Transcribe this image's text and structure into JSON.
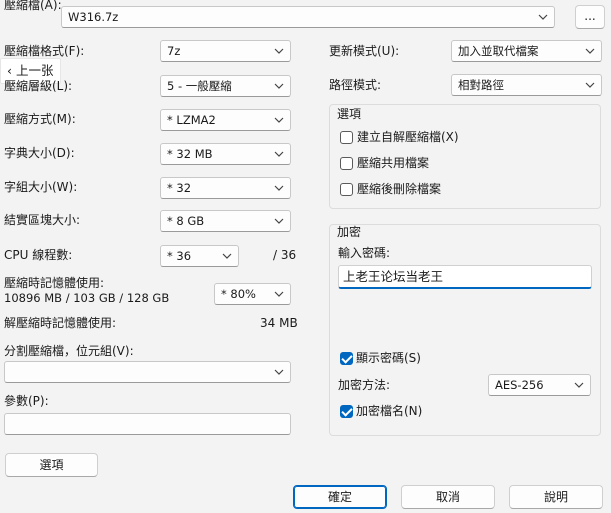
{
  "archive": {
    "label": "壓縮檔(A):",
    "value": "W316.7z",
    "browse_label": "..."
  },
  "back_tip": {
    "label": "上一张"
  },
  "left": {
    "format": {
      "label": "壓縮檔格式(F):",
      "value": "7z"
    },
    "level": {
      "label": "壓縮層級(L):",
      "value": "5 - 一般壓縮"
    },
    "method": {
      "label": "壓縮方式(M):",
      "value": "* LZMA2"
    },
    "dict": {
      "label": "字典大小(D):",
      "value": "* 32 MB"
    },
    "word": {
      "label": "字組大小(W):",
      "value": "* 32"
    },
    "solid": {
      "label": "結實區塊大小:",
      "value": "* 8 GB"
    },
    "cpu": {
      "label": "CPU 線程數:",
      "value": "* 36",
      "max": "/ 36"
    },
    "mem": {
      "label": "壓縮時記憶體使用:",
      "detail": "10896 MB / 103 GB / 128 GB",
      "value": "* 80%"
    },
    "decomp": {
      "label": "解壓縮時記憶體使用:",
      "value": "34 MB"
    },
    "split": {
      "label": "分割壓縮檔，位元組(V):",
      "value": ""
    },
    "params": {
      "label": "參數(P):",
      "value": ""
    },
    "options_button": "選項"
  },
  "right": {
    "update": {
      "label": "更新模式(U):",
      "value": "加入並取代檔案"
    },
    "path": {
      "label": "路徑模式:",
      "value": "相對路徑"
    },
    "options_group": {
      "title": "選項",
      "sfx": "建立自解壓縮檔(X)",
      "shared": "壓縮共用檔案",
      "delete_after": "壓縮後刪除檔案"
    },
    "encryption": {
      "title": "加密",
      "enter_label": "輸入密碼:",
      "password": "上老王论坛当老王",
      "show_label": "顯示密碼(S)",
      "method_label": "加密方法:",
      "method_value": "AES-256",
      "names_label": "加密檔名(N)"
    }
  },
  "buttons": {
    "ok": "確定",
    "cancel": "取消",
    "help": "說明"
  },
  "colors": {
    "accent": "#0067c0",
    "background": "#f3f3f3"
  }
}
